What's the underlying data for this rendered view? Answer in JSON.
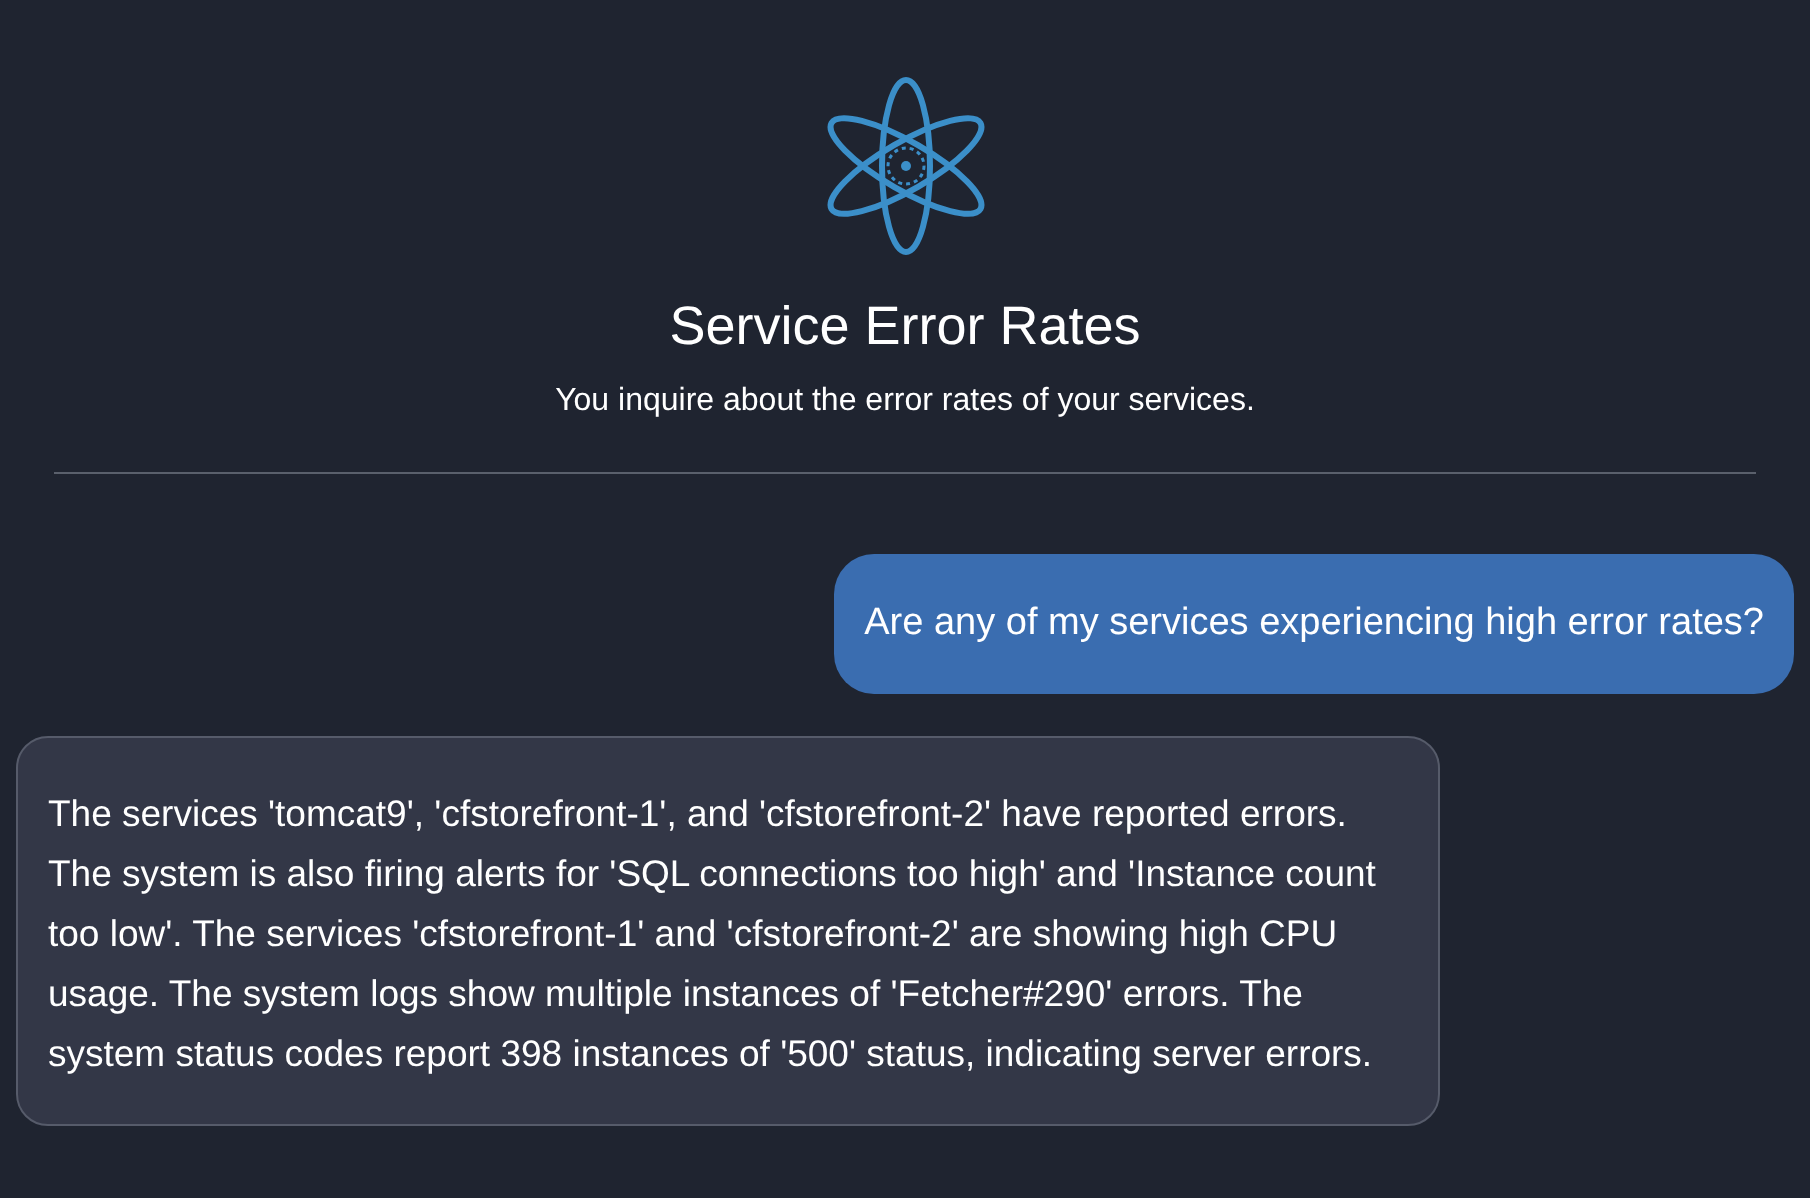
{
  "header": {
    "title": "Service Error Rates",
    "subtitle": "You inquire about the error rates of your services."
  },
  "messages": [
    {
      "kind": "user",
      "text": "Are any of my services experiencing high error rates?"
    },
    {
      "kind": "assistant",
      "text": "The services 'tomcat9', 'cfstorefront-1', and 'cfstorefront-2' have reported errors. The system is also firing alerts for 'SQL connections too high' and 'Instance count too low'. The services 'cfstorefront-1' and 'cfstorefront-2' are showing high CPU usage. The system logs show multiple instances of 'Fetcher#290' errors. The system status codes report 398 instances of '500' status, indicating server errors."
    }
  ]
}
